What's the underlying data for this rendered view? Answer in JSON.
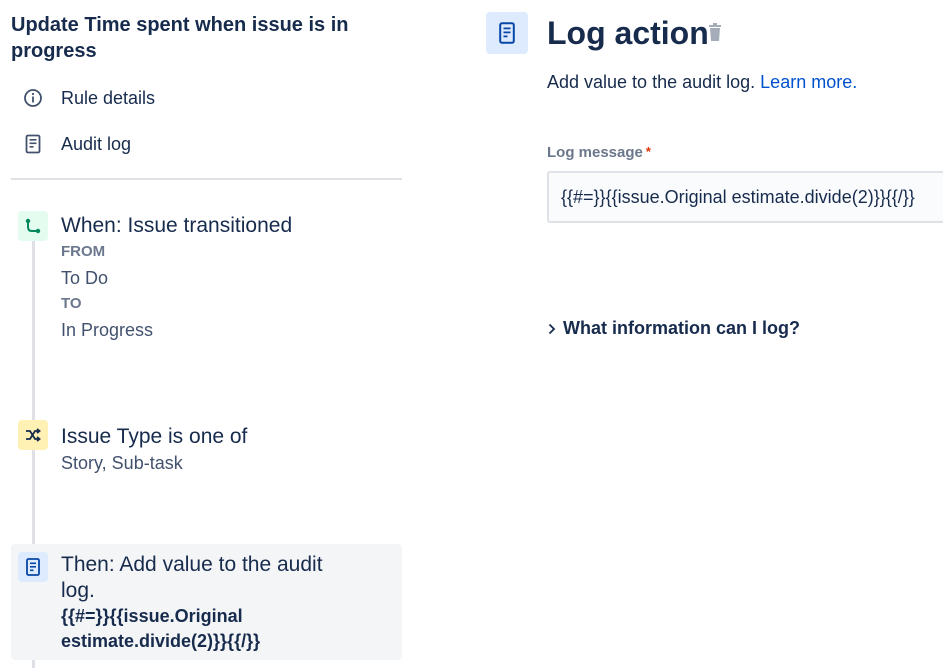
{
  "rule": {
    "title": "Update Time spent when issue is in progress"
  },
  "nav": {
    "rule_details": "Rule details",
    "audit_log": "Audit log"
  },
  "steps": {
    "trigger": {
      "heading": "When: Issue transitioned",
      "from_label": "FROM",
      "from_value": "To Do",
      "to_label": "TO",
      "to_value": "In Progress",
      "icon": "branch-icon"
    },
    "condition": {
      "heading": "Issue Type is one of",
      "value": "Story, Sub-task",
      "icon": "shuffle-icon"
    },
    "action": {
      "heading": "Then: Add value to the audit log.",
      "smart_value": "{{#=}}{{issue.Original estimate.divide(2)}}{{/}}",
      "icon": "document-icon"
    }
  },
  "panel": {
    "title": "Log action",
    "description": "Add value to the audit log.",
    "learn_more": "Learn more.",
    "field_label": "Log message",
    "required_marker": "*",
    "field_value": "{{#=}}{{issue.Original estimate.divide(2)}}{{/}}",
    "expander_label": "What information can I log?"
  },
  "colors": {
    "trigger_badge": "#e3fcef",
    "condition_badge": "#fff0b3",
    "action_badge": "#deebff",
    "link": "#0052cc",
    "required": "#de350b"
  }
}
